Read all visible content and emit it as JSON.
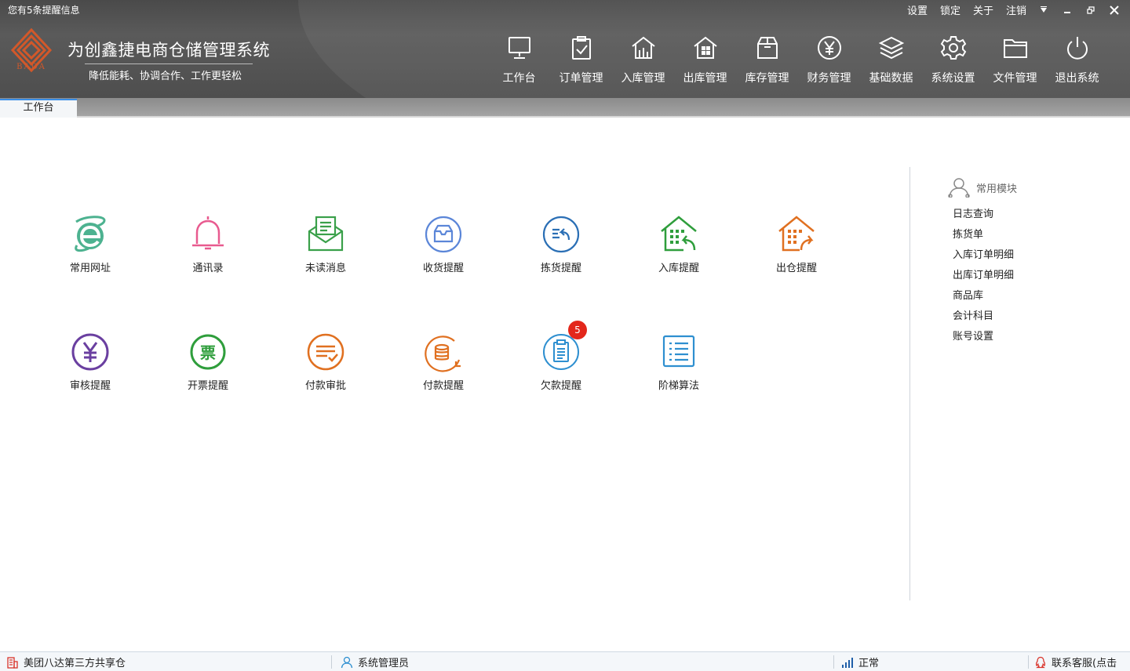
{
  "header": {
    "notice": "您有5条提醒信息",
    "logo_text": "BADA",
    "title": "为创鑫捷电商仓储管理系统",
    "slogan": "降低能耗、协调合作、工作更轻松",
    "top_links": [
      "设置",
      "锁定",
      "关于",
      "注销"
    ]
  },
  "nav": [
    {
      "label": "工作台",
      "icon": "monitor-icon"
    },
    {
      "label": "订单管理",
      "icon": "clipboard-check-icon"
    },
    {
      "label": "入库管理",
      "icon": "warehouse-in-icon"
    },
    {
      "label": "出库管理",
      "icon": "warehouse-out-icon"
    },
    {
      "label": "库存管理",
      "icon": "box-icon"
    },
    {
      "label": "财务管理",
      "icon": "yen-circle-icon"
    },
    {
      "label": "基础数据",
      "icon": "layers-icon"
    },
    {
      "label": "系统设置",
      "icon": "gear-icon"
    },
    {
      "label": "文件管理",
      "icon": "folder-icon"
    },
    {
      "label": "退出系统",
      "icon": "power-icon"
    }
  ],
  "tabs": [
    {
      "label": "工作台"
    }
  ],
  "tiles": [
    {
      "label": "常用网址",
      "icon": "ie-browser-icon",
      "color": "#4db290"
    },
    {
      "label": "通讯录",
      "icon": "bell-icon",
      "color": "#e85a8f"
    },
    {
      "label": "未读消息",
      "icon": "envelope-icon",
      "color": "#3aa04a"
    },
    {
      "label": "收货提醒",
      "icon": "inbox-icon",
      "color": "#5b86d8"
    },
    {
      "label": "拣货提醒",
      "icon": "pick-icon",
      "color": "#2b6fb5"
    },
    {
      "label": "入库提醒",
      "icon": "warehouse-in-icon",
      "color": "#2f9e3c"
    },
    {
      "label": "出仓提醒",
      "icon": "warehouse-out-icon",
      "color": "#e07020"
    },
    {
      "label": "审核提醒",
      "icon": "yen-circle-icon",
      "color": "#6a3fa0"
    },
    {
      "label": "开票提醒",
      "icon": "invoice-icon",
      "color": "#2f9e3c"
    },
    {
      "label": "付款审批",
      "icon": "list-check-icon",
      "color": "#e07020"
    },
    {
      "label": "付款提醒",
      "icon": "coins-icon",
      "color": "#e07020"
    },
    {
      "label": "欠款提醒",
      "icon": "clipboard-icon",
      "color": "#2e8fd0",
      "badge": "5"
    },
    {
      "label": "阶梯算法",
      "icon": "list-icon",
      "color": "#2e8fd0"
    }
  ],
  "quick": {
    "title": "常用模块",
    "items": [
      "日志查询",
      "拣货单",
      "入库订单明细",
      "出库订单明细",
      "商品库",
      "会计科目",
      "账号设置"
    ]
  },
  "status": {
    "warehouse": "美团八达第三方共享仓",
    "user": "系统管理员",
    "network": "正常",
    "support": "联系客服(点击"
  },
  "colors": {
    "tab_accent": "#3a8ee6",
    "badge": "#e3271b",
    "logo": "#d2582a"
  }
}
